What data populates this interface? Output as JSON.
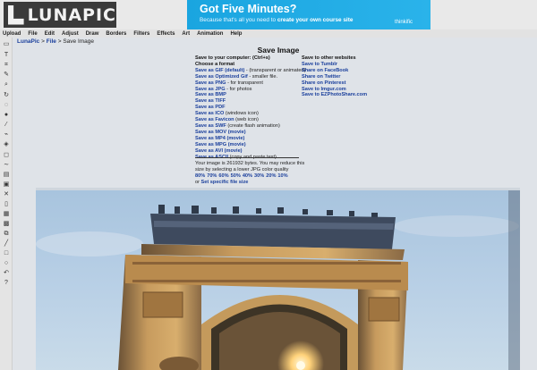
{
  "app": {
    "logo_text": "LUNAPIC"
  },
  "ad": {
    "title": "Got Five Minutes?",
    "subtitle_pre": "Because that's all you need to ",
    "subtitle_bold": "create your own course site",
    "brand": "thinkific",
    "accent": "#1aa5e0"
  },
  "menu": [
    "Upload",
    "File",
    "Edit",
    "Adjust",
    "Draw",
    "Borders",
    "Filters",
    "Effects",
    "Art",
    "Animation",
    "Help"
  ],
  "breadcrumb": {
    "root": "LunaPic",
    "sep1": " > ",
    "file": "File",
    "sep2": " > ",
    "current": "Save Image"
  },
  "save": {
    "title": "Save Image",
    "computer_heading": "Save to your computer: (Ctrl+s)",
    "choose_format": "Choose a format",
    "formats": [
      {
        "link": "Save as GIF (default)",
        "desc": " - (transparent or animated)"
      },
      {
        "link": "Save as Optimized Gif",
        "desc": " - smaller file."
      },
      {
        "link": "Save as PNG",
        "desc": " - for transparent"
      },
      {
        "link": "Save as JPG",
        "desc": " - for photos"
      },
      {
        "link": "Save as BMP",
        "desc": ""
      },
      {
        "link": "Save as TIFF",
        "desc": ""
      },
      {
        "link": "Save as PDF",
        "desc": ""
      },
      {
        "link": "Save as ICO",
        "desc": " (windows icon)"
      },
      {
        "link": "Save as Favicon",
        "desc": " (web icon)"
      },
      {
        "link": "Save as SWF",
        "desc": " (create flash animation)"
      },
      {
        "link": "Save as MOV (movie)",
        "desc": ""
      },
      {
        "link": "Save as MP4 (movie)",
        "desc": ""
      },
      {
        "link": "Save as MPG (movie)",
        "desc": ""
      },
      {
        "link": "Save as AVI (movie)",
        "desc": ""
      },
      {
        "link": "Save as ASCII",
        "desc": " (copy and paste text)"
      }
    ],
    "other_heading": "Save to other websites",
    "other_links": [
      "Save to Tumblr",
      "Share on FaceBook",
      "Share on Twitter",
      "Share on Pinterest",
      "Save to Imgur.com",
      "Save to EZPhotoShare.com"
    ],
    "info_line1": "Your image is 261932 bytes. You may reduce this",
    "info_line2": "size by selecting a lower JPG color quality",
    "qualities": [
      "80%",
      "70%",
      "60%",
      "50%",
      "40%",
      "30%",
      "20%",
      "10%"
    ],
    "or_text": "or ",
    "specific_size": "Set specific file size"
  }
}
